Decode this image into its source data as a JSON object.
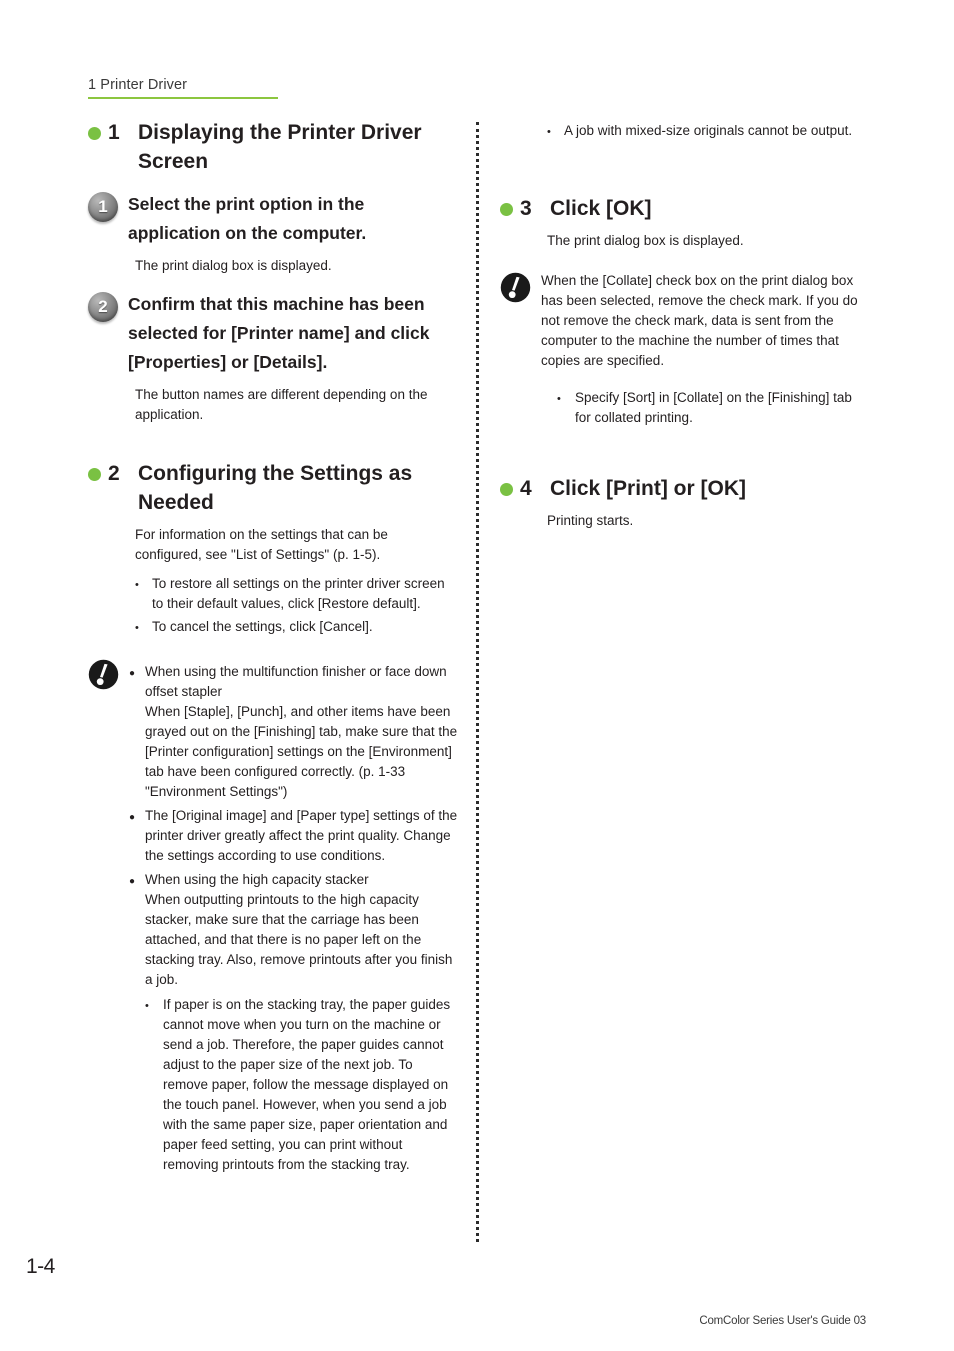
{
  "header": {
    "running_title": "1 Printer Driver",
    "rule_color": "#8cc63f"
  },
  "theme": {
    "accent_green": "#7ac143",
    "text_color": "#231f20"
  },
  "left_column": {
    "section1": {
      "number": "1",
      "title": "Displaying the Printer Driver Screen",
      "steps": [
        {
          "number": "1",
          "title": "Select the print option in the application on the computer.",
          "body": "The print dialog box is displayed."
        },
        {
          "number": "2",
          "title": "Confirm that this machine has been selected for [Printer name] and click [Properties] or [Details].",
          "body": "The button names are different depending on the application."
        }
      ]
    },
    "section2": {
      "number": "2",
      "title": "Configuring the Settings as Needed",
      "body": "For information on the settings that can be configured, see \"List of Settings\" (p. 1-5).",
      "bullets": [
        "To restore all settings on the printer driver screen to their default values, click [Restore default].",
        "To cancel the settings, click [Cancel]."
      ],
      "note": {
        "icon": "warning-bang-icon",
        "items": [
          "When using the multifunction finisher or face down offset stapler\nWhen [Staple], [Punch], and other items have been grayed out on the [Finishing] tab, make sure that the [Printer configuration] settings on the [Environment] tab have been configured correctly. (p. 1-33 \"Environment Settings\")",
          "The [Original image] and [Paper type] settings of the printer driver greatly affect the print quality. Change the settings according to use conditions.",
          "When using the high capacity stacker\nWhen outputting printouts to the high capacity stacker, make sure that the carriage has been attached, and that there is no paper left on the stacking tray. Also, remove printouts after you finish a job."
        ],
        "sub_bullets": [
          "If paper is on the stacking tray, the paper guides cannot move when you turn on the machine or send a job. Therefore, the paper guides cannot adjust to the paper size of the next job. To remove paper, follow the message displayed on the touch panel. However, when you send a job with the same paper size, paper orientation and paper feed setting, you can print without removing printouts from the stacking tray."
        ]
      }
    }
  },
  "right_column": {
    "top_bullets": [
      "A job with mixed-size originals cannot be output."
    ],
    "section3": {
      "number": "3",
      "title": "Click [OK]",
      "body": "The print dialog box is displayed.",
      "note": {
        "icon": "warning-bang-icon",
        "text": "When the [Collate] check box on the print dialog box has been selected, remove the check mark. If you do not remove the check mark, data is sent from the computer to the machine the number of times that copies are specified.",
        "sub_bullets": [
          "Specify [Sort] in [Collate] on the [Finishing] tab for collated printing."
        ]
      }
    },
    "section4": {
      "number": "4",
      "title": "Click [Print] or [OK]",
      "body": "Printing starts."
    }
  },
  "footer": {
    "page_number": "1-4",
    "credit": "ComColor Series User's Guide 03"
  }
}
